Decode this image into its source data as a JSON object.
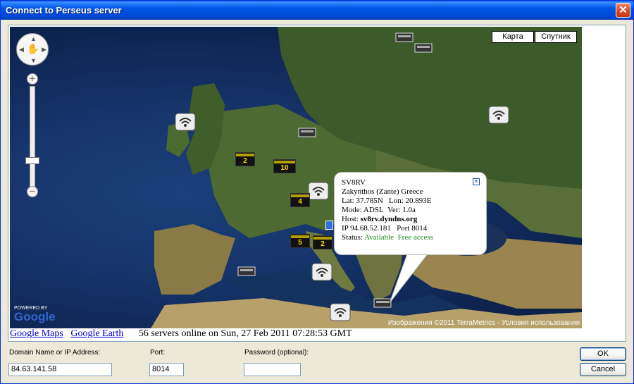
{
  "window": {
    "title": "Connect to Perseus server",
    "close_glyph": "✕"
  },
  "map": {
    "tile_buttons": [
      {
        "label": "Карта"
      },
      {
        "label": "Спутник"
      }
    ],
    "attribution": "Изображения ©2011 TerraMetrics - Условия использования",
    "google_logo": "Google",
    "powered_by": "POWERED BY",
    "cluster_brand": "PERSEUS",
    "clusters": [
      {
        "id": "c1",
        "count": "2"
      },
      {
        "id": "c2",
        "count": "10"
      },
      {
        "id": "c3",
        "count": "4"
      },
      {
        "id": "c4",
        "count": "5"
      },
      {
        "id": "c5",
        "count": "2"
      }
    ],
    "popup": {
      "callsign": "SV8RV",
      "location": "Zakynthos (Zante) Greece",
      "lat_label": "Lat:",
      "lat": "37.785N",
      "lon_label": "Lon:",
      "lon": "20.893E",
      "mode_label": "Mode:",
      "mode": "ADSL",
      "ver_label": "Ver:",
      "ver": "1.0a",
      "host_label": "Host:",
      "host": "sv8rv.dyndns.org",
      "ip_label": "IP",
      "ip": "94.68.52.181",
      "port_label": "Port",
      "port": "8014",
      "status_label": "Status:",
      "status": "Available",
      "access": "Free access"
    }
  },
  "bottombar": {
    "link_google_maps": "Google Maps",
    "link_google_earth": "Google Earth",
    "status": "56 servers online on  Sun, 27 Feb 2011 07:28:53 GMT"
  },
  "form": {
    "domain_label": "Domain Name or IP Address:",
    "domain_value": "84.63.141.58",
    "port_label": "Port:",
    "port_value": "8014",
    "password_label": "Password  (optional):",
    "password_value": ""
  },
  "buttons": {
    "ok": "OK",
    "cancel": "Cancel"
  },
  "colors": {
    "title_bar": "#0055e5",
    "link": "#0000cc",
    "available": "#1a8a1a",
    "cluster_text": "#ffd900"
  }
}
